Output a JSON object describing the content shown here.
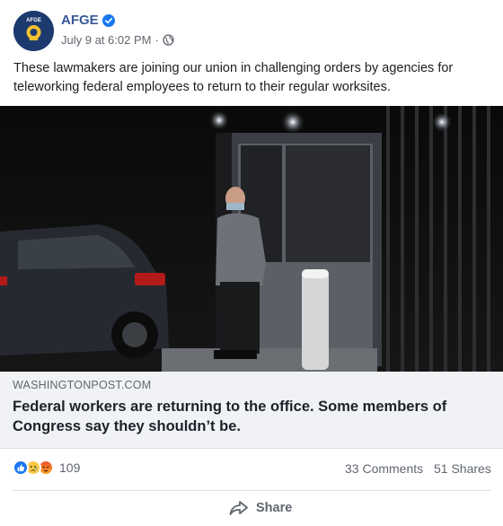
{
  "post": {
    "page_name": "AFGE",
    "avatar_text": "AFGE",
    "timestamp": "July 9 at 6:02 PM",
    "separator": "·",
    "text": "These lawmakers are joining our union in challenging orders by agencies for teleworking federal employees to return to their regular worksites."
  },
  "link": {
    "domain": "WASHINGTONPOST.COM",
    "title": "Federal workers are returning to the office. Some members of Congress say they shouldn’t be."
  },
  "stats": {
    "reaction_icons": [
      "like-icon",
      "sad-icon",
      "angry-icon"
    ],
    "reaction_count": "109",
    "comments": "33 Comments",
    "shares": "51 Shares"
  },
  "actions": {
    "share_label": "Share"
  },
  "colors": {
    "brand_link": "#385898",
    "verified": "#1877f2",
    "muted_text": "#616770",
    "link_preview_bg": "#f0f2f5"
  }
}
